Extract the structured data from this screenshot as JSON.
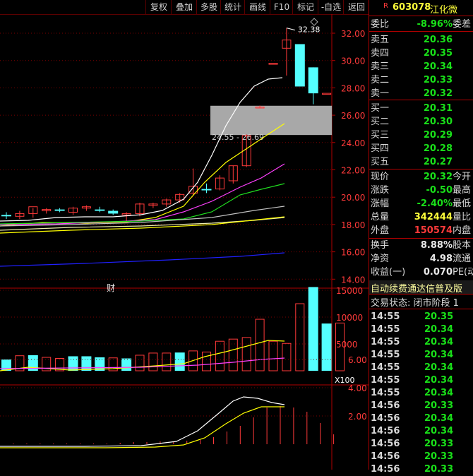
{
  "toolbar": {
    "buttons": [
      "复权",
      "叠加",
      "多股",
      "统计",
      "画线",
      "F10",
      "标记",
      "-自选",
      "返回"
    ]
  },
  "chart": {
    "price_axis": [
      "32.00",
      "30.00",
      "28.00",
      "26.00",
      "24.00",
      "22.00",
      "20.00",
      "18.00",
      "16.00",
      "14.00"
    ],
    "high_label": "32.38",
    "range_label": "24.55 - 26.69",
    "cai_label": "财",
    "vol_axis": [
      "15000",
      "10000",
      "5000"
    ],
    "vol_unit": "X100",
    "ind_axis": [
      "6.00",
      "4.00",
      "2.00"
    ]
  },
  "chart_data": {
    "type": "candlestick",
    "candles": [
      {
        "o": 18.7,
        "h": 18.9,
        "l": 18.4,
        "c": 18.6
      },
      {
        "o": 18.6,
        "h": 19.0,
        "l": 18.4,
        "c": 18.8
      },
      {
        "o": 18.8,
        "h": 19.2,
        "l": 18.5,
        "c": 19.3
      },
      {
        "o": 19.0,
        "h": 19.2,
        "l": 18.8,
        "c": 19.1
      },
      {
        "o": 19.1,
        "h": 19.2,
        "l": 18.9,
        "c": 19.0
      },
      {
        "o": 18.9,
        "h": 19.3,
        "l": 18.7,
        "c": 19.2
      },
      {
        "o": 19.2,
        "h": 19.4,
        "l": 19.0,
        "c": 19.3
      },
      {
        "o": 19.1,
        "h": 19.3,
        "l": 18.9,
        "c": 19.0
      },
      {
        "o": 19.0,
        "h": 19.1,
        "l": 18.7,
        "c": 18.8
      },
      {
        "o": 18.7,
        "h": 18.9,
        "l": 18.2,
        "c": 18.8
      },
      {
        "o": 18.8,
        "h": 19.6,
        "l": 18.6,
        "c": 19.5
      },
      {
        "o": 19.4,
        "h": 19.6,
        "l": 19.2,
        "c": 19.5
      },
      {
        "o": 19.5,
        "h": 19.9,
        "l": 19.3,
        "c": 19.8
      },
      {
        "o": 19.8,
        "h": 20.3,
        "l": 19.6,
        "c": 20.2
      },
      {
        "o": 20.3,
        "h": 22.1,
        "l": 20.1,
        "c": 20.8
      },
      {
        "o": 20.6,
        "h": 21.0,
        "l": 20.3,
        "c": 20.5
      },
      {
        "o": 20.6,
        "h": 21.6,
        "l": 20.5,
        "c": 21.4
      },
      {
        "o": 21.2,
        "h": 22.3,
        "l": 21.0,
        "c": 22.3
      },
      {
        "o": 22.3,
        "h": 24.6,
        "l": 22.2,
        "c": 24.5
      },
      {
        "o": 26.6,
        "h": 26.7,
        "l": 26.5,
        "c": 26.6
      },
      {
        "o": 29.8,
        "h": 29.8,
        "l": 29.8,
        "c": 29.8
      },
      {
        "o": 30.9,
        "h": 32.38,
        "l": 28.9,
        "c": 31.5
      },
      {
        "o": 31.2,
        "h": 31.2,
        "l": 28.1,
        "c": 28.1
      },
      {
        "o": 29.5,
        "h": 29.5,
        "l": 26.8,
        "c": 27.6
      },
      {
        "o": 27.6,
        "h": 27.6,
        "l": 27.6,
        "c": 27.6
      }
    ],
    "volume": [
      2100,
      2800,
      2900,
      2500,
      2300,
      2700,
      2700,
      2500,
      2400,
      2300,
      2900,
      3300,
      3300,
      3400,
      3700,
      3500,
      5500,
      5900,
      6200,
      9600,
      5500,
      5100,
      12500,
      15600,
      8800,
      8900
    ],
    "y_range": [
      13.5,
      33.0
    ]
  },
  "quote": {
    "flag": "R",
    "code": "603078",
    "name": "江化微",
    "rows": [
      {
        "label": "委比",
        "value": "-8.96%",
        "extra": "委差",
        "color": "green"
      },
      {
        "label": "卖五",
        "value": "20.36",
        "extra": "",
        "color": "green"
      },
      {
        "label": "卖四",
        "value": "20.35",
        "extra": "",
        "color": "green"
      },
      {
        "label": "卖三",
        "value": "20.34",
        "extra": "",
        "color": "green"
      },
      {
        "label": "卖二",
        "value": "20.33",
        "extra": "",
        "color": "green"
      },
      {
        "label": "卖一",
        "value": "20.32",
        "extra": "",
        "color": "green"
      },
      {
        "label": "买一",
        "value": "20.31",
        "extra": "",
        "color": "green"
      },
      {
        "label": "买二",
        "value": "20.30",
        "extra": "",
        "color": "green"
      },
      {
        "label": "买三",
        "value": "20.29",
        "extra": "",
        "color": "green"
      },
      {
        "label": "买四",
        "value": "20.28",
        "extra": "",
        "color": "green"
      },
      {
        "label": "买五",
        "value": "20.27",
        "extra": "",
        "color": "green"
      },
      {
        "label": "现价",
        "value": "20.32",
        "extra": "今开",
        "color": "green"
      },
      {
        "label": "涨跌",
        "value": "-0.50",
        "extra": "最高",
        "color": "green"
      },
      {
        "label": "涨幅",
        "value": "-2.40%",
        "extra": "最低",
        "color": "green"
      },
      {
        "label": "总量",
        "value": "342444",
        "extra": "量比",
        "color": "yellow"
      },
      {
        "label": "外盘",
        "value": "150574",
        "extra": "内盘",
        "color": "red"
      },
      {
        "label": "换手",
        "value": "8.88%",
        "extra": "股本",
        "color": "white"
      },
      {
        "label": "净资",
        "value": "4.98",
        "extra": "流通",
        "color": "white"
      },
      {
        "label": "收益(一)",
        "value": "0.070",
        "extra": "PE(动",
        "color": "white"
      }
    ],
    "scroll_text": "自动续费通达信普及版",
    "status_text": "交易状态: 闭市阶段 1"
  },
  "ticks": [
    {
      "t": "14:55",
      "p": "20.35"
    },
    {
      "t": "14:55",
      "p": "20.34"
    },
    {
      "t": "14:55",
      "p": "20.34"
    },
    {
      "t": "14:55",
      "p": "20.34"
    },
    {
      "t": "14:55",
      "p": "20.34"
    },
    {
      "t": "14:55",
      "p": "20.34"
    },
    {
      "t": "14:55",
      "p": "20.34"
    },
    {
      "t": "14:56",
      "p": "20.33"
    },
    {
      "t": "14:56",
      "p": "20.34"
    },
    {
      "t": "14:56",
      "p": "20.34"
    },
    {
      "t": "14:56",
      "p": "20.33"
    },
    {
      "t": "14:56",
      "p": "20.33"
    },
    {
      "t": "14:56",
      "p": "20.33"
    }
  ]
}
